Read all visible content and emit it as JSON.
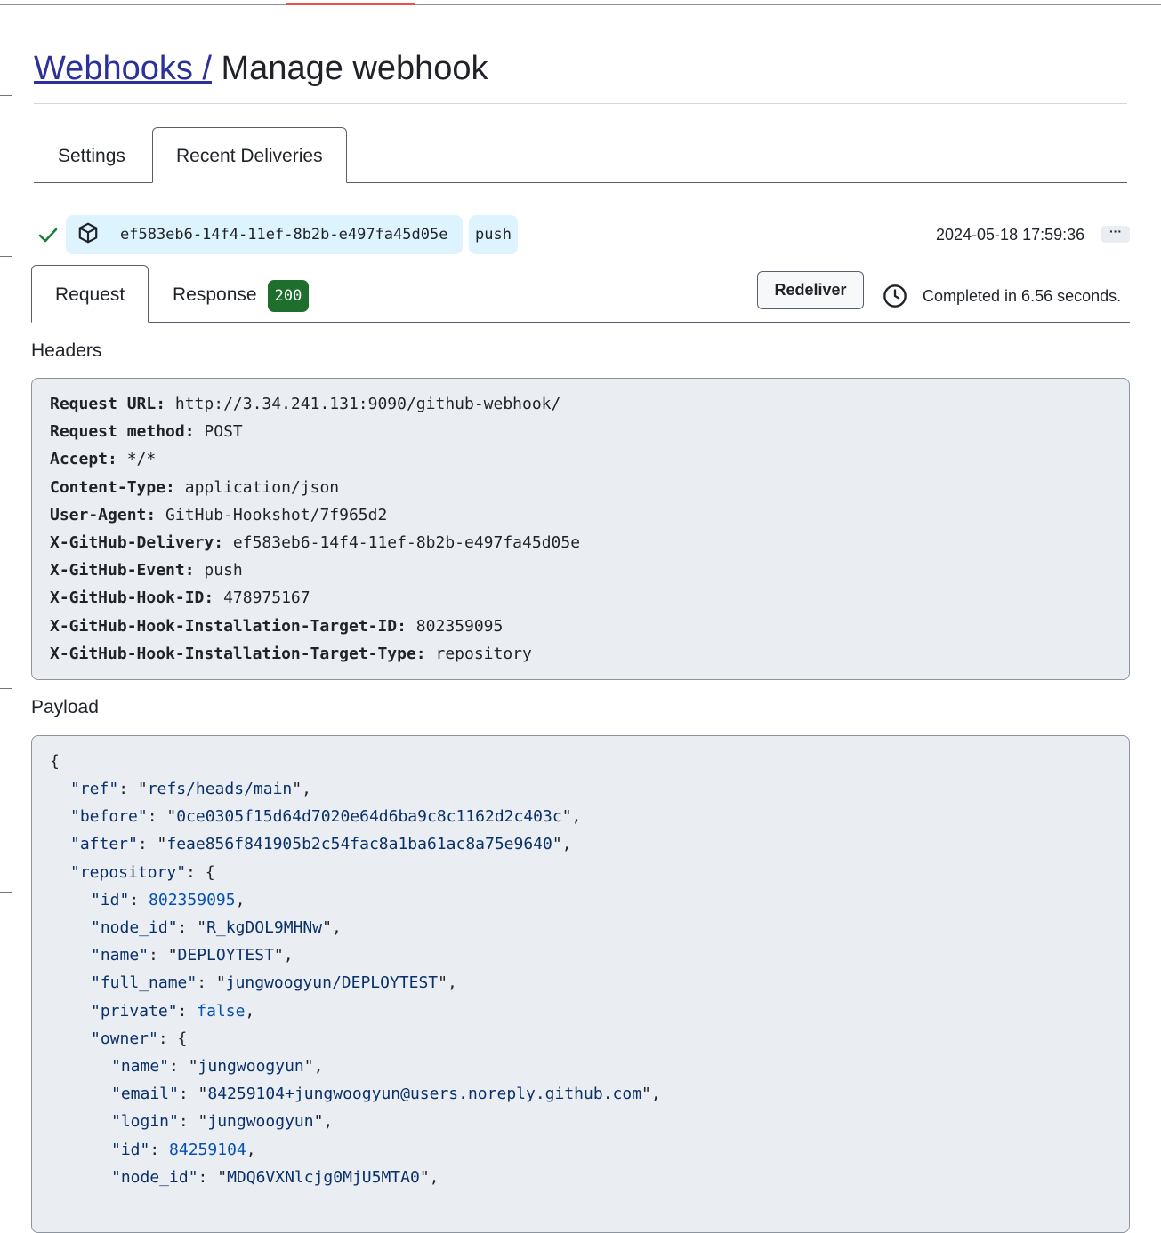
{
  "breadcrumb": {
    "link_label": "Webhooks /",
    "current": "Manage webhook"
  },
  "tabs": [
    {
      "label": "Settings"
    },
    {
      "label": "Recent Deliveries"
    }
  ],
  "delivery": {
    "guid": "ef583eb6-14f4-11ef-8b2b-e497fa45d05e",
    "event": "push",
    "timestamp": "2024-05-18 17:59:36",
    "more_label": "···"
  },
  "detail_tabs": {
    "request_label": "Request",
    "response_label": "Response",
    "status_code": "200"
  },
  "redeliver_label": "Redeliver",
  "completed_text": "Completed in 6.56 seconds.",
  "headers_title": "Headers",
  "payload_title": "Payload",
  "headers": [
    {
      "key": "Request URL:",
      "value": " http://3.34.241.131:9090/github-webhook/"
    },
    {
      "key": "Request method:",
      "value": " POST"
    },
    {
      "key": "Accept:",
      "value": " */*"
    },
    {
      "key": "Content-Type:",
      "value": " application/json"
    },
    {
      "key": "User-Agent:",
      "value": " GitHub-Hookshot/7f965d2"
    },
    {
      "key": "X-GitHub-Delivery:",
      "value": " ef583eb6-14f4-11ef-8b2b-e497fa45d05e"
    },
    {
      "key": "X-GitHub-Event:",
      "value": " push"
    },
    {
      "key": "X-GitHub-Hook-ID:",
      "value": " 478975167"
    },
    {
      "key": "X-GitHub-Hook-Installation-Target-ID:",
      "value": " 802359095"
    },
    {
      "key": "X-GitHub-Hook-Installation-Target-Type:",
      "value": " repository"
    }
  ],
  "payload": {
    "open_brace": "{",
    "ref": "refs/heads/main",
    "before": "0ce0305f15d64d7020e64d6ba9c8c1162d2c403c",
    "after": "feae856f841905b2c54fac8a1ba61ac8a75e9640",
    "repository": {
      "id": "802359095",
      "node_id": "R_kgDOL9MHNw",
      "name": "DEPLOYTEST",
      "full_name": "jungwoogyun/DEPLOYTEST",
      "private": "false",
      "owner": {
        "name": "jungwoogyun",
        "email": "84259104+jungwoogyun@users.noreply.github.com",
        "login": "jungwoogyun",
        "id": "84259104",
        "node_id": "MDQ6VXNlcjg0MjU5MTA0"
      }
    }
  },
  "colors": {
    "link": "#2c3199",
    "accent_tab": "#e5534b",
    "badge_green": "#1f6f2c",
    "pill_bg": "#ddf4ff",
    "code_bg": "#eaeef2",
    "check_green": "#1a7f37"
  }
}
